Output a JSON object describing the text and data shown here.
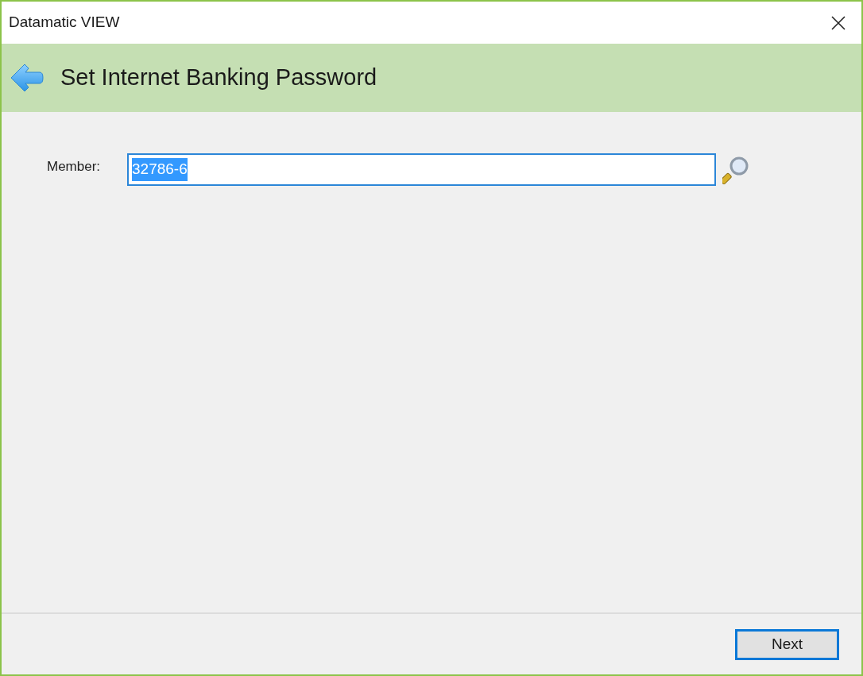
{
  "window": {
    "title": "Datamatic VIEW"
  },
  "header": {
    "title": "Set Internet Banking Password"
  },
  "member_field": {
    "label": "Member:",
    "value": "32786-6",
    "text_selected": true,
    "focused": true
  },
  "buttons": [
    {
      "label": "Next",
      "focused": true
    }
  ]
}
